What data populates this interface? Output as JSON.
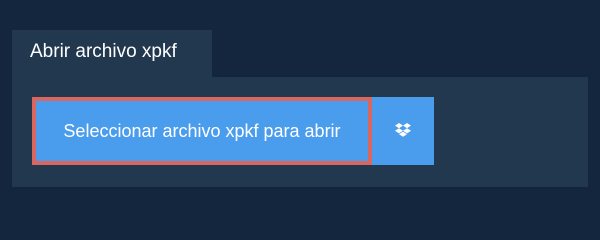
{
  "tab": {
    "title": "Abrir archivo xpkf"
  },
  "panel": {
    "select_button_label": "Seleccionar archivo xpkf para abrir",
    "dropbox_button_icon": "dropbox-icon"
  },
  "colors": {
    "background": "#13263d",
    "panel": "#22384f",
    "button": "#4a9ced",
    "highlight_border": "#d9675f"
  }
}
